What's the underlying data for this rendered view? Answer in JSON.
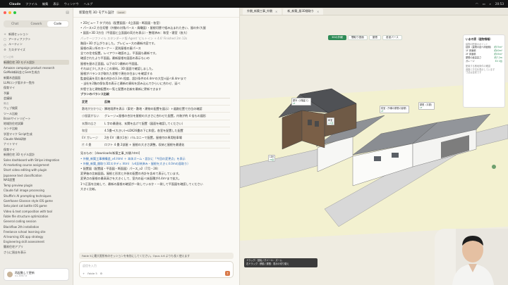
{
  "menubar": {
    "app": "Claude",
    "items": [
      "ファイル",
      "編集",
      "表示",
      "ウィンドウ",
      "ヘルプ"
    ],
    "clock": "20:53"
  },
  "sidebar": {
    "tabs": [
      "Chat",
      "Cowork",
      "Code"
    ],
    "active_tab": "Code",
    "nav": [
      {
        "icon": "+",
        "label": "新規セッション"
      },
      {
        "icon": "▢",
        "label": "アーティファクト"
      },
      {
        "icon": "◷",
        "label": "ルーティン"
      },
      {
        "icon": "⚙",
        "label": "カスタマイズ"
      }
    ],
    "pinned_section": "ピン止め",
    "pinned": [
      "新規住宅 3D モデル設計",
      "Amazon campaign product research",
      "GoMob新料金とGem生成方",
      "新築木造図面",
      "LLMロング版ネタ一覧作",
      "保育マイ",
      "予算",
      "会議録"
    ],
    "recents_section": "最近",
    "recents": [
      "ウェブ検索",
      "ツール比較",
      "Brainサイトリピート",
      "地域別住宅試算",
      "ランチ比較",
      "学習マイク Script生成",
      "Claude Web研修",
      "ナイトマイ",
      "保育マイ",
      "新規住宅 3D モデル設計",
      "Sales dashboard with Stripe integration",
      "AI marketing course assignment",
      "Short video editing with plugin",
      "Japanese text classification",
      "NAS設置",
      "Temp preview plugin",
      "Claude full image processing",
      "Shuffle's AI prompting techniques",
      "Gamfoane Glasnon style iOS game",
      "Seto plant cat battle iOS game",
      "Video & text composition with tool",
      "Fable file structure optimization",
      "General coding session",
      "Blackflow 2th installation",
      "Freelance school learning site",
      "AI learning iOS app strategy",
      "Engineering skill assessment",
      "簡易住宅アプリ",
      "さらに過去を表示"
    ],
    "user_name": "再起動して更新",
    "user_sub": "v1.3567.0",
    "bottom_label": "じゅりりー・Max"
  },
  "chat": {
    "title": "新築住宅 3D モデル設計",
    "title_badge": "Local",
    "lines": [
      "• 2Dビュー 7 タブ対応（配置図面・4立面図・断面図・各室）",
      "• パース×2 方位切替（外観の対角パース・鳥瞰図）・屋根切替で組み込まれた合い、屋の外/大屋",
      "• 図面+3D 3方位（平面図と立面図の両方を表示）・整理済み：和室・寝室（各大）",
      "パッケージファイル  スタンダード版  Agent 'ビルトイン + 4.6' Finished 2m 12s",
      "階段+3D が上がりました。プレビュー大の最新内容です。",
      "屋根の高い所のコーナー・変則屋根の屋パース",
      "全ての住宅配置。レイアウト確認の上、平面図も最新です。",
      "確認されたより平面図。最新屋根を図面の表示もいの",
      "屋根を屋の正面図。以下の1つ最新の平面図。",
      "それほど少し大きくこの資料。3D 図面で確認しました。",
      "屋根がバランスが取れた状態で現在の住まいを確認する",
      "監査役員を見た後の合計の3.3m 程度、設計条件の4.4m²の大型×延べ8.4m²まで",
      "・当社を2階の保存用の表示と最新の資料を読み込んでからいに合わせ、延べ",
      "外壁寸法と建物配置の一覧と配置の比較を最新に更新できます",
      "プランのバランス比較"
    ],
    "table": {
      "headers": [
        "変更",
        "反映"
      ],
      "rows": [
        [
          "敷地が分かりにくい",
          "隣地境界を表示（東宅・敷地・建物の配置を図示）+道路位置で方位の確認"
        ],
        [
          "小屋裏がない",
          "グレージュ屋根の合計を屋根の大きさに合わせた配置。内装が約 4 倍もの図形"
        ],
        [
          "玄関の広さ",
          "L 字の最適化、玄関を広げて配置（図面を確認してください）"
        ],
        [
          "和室",
          "4.5畳→(大きい)→LDK26畳の下に和室。各室を配置した配置"
        ],
        [
          "EV ガレージ",
          "2台 EV（最大1台）バルコニーで配置。屋根付の専用駐車場"
        ],
        [
          "片 4 畳",
          "ロフト 4 畳 2部屋 + 屋根の大きさ調整。収納と屋根を最適化"
        ]
      ]
    },
    "after_lines": [
      "見るもの：[downloads/新築工事_外観.html]",
      "• 外観_新築工事棟構造_v4.html ＋ 本体ズーム・設計に「今回の変更点」を表示",
      "• 外観_新築_間取り3Dスタディ.html （v4反映済み・屋根を大きく4.0mの面取り）",
      "• 配置図（配置図・平面図・断面図）パース_v2（7月・28）",
      "変更後の比較図面。屋根と形状と外装の配置の合計を含めて表示しています。",
      "変更点の屋根の最高高さを大きくして、室内の延べ床面積が4.4m²まで拡大。",
      "1つ正面を比較して、最新の屋根の確認が一致しているか・一致して平面図を確認してください",
      "大きく比較。"
    ],
    "notice": "Fable 5に最大限所有のセッションを有効にしてください。Opus 4.6 よりも長く使えます",
    "composer_placeholder": "返信を入力",
    "composer_tools": [
      "+",
      "Fable 5",
      "⚙"
    ]
  },
  "viewer": {
    "tabs": [
      {
        "label": "外観_新築工事_外観",
        "closable": true
      },
      {
        "label": "新_新築_屋3D間取り",
        "closable": true
      }
    ],
    "view_buttons": [
      "3Dの外観",
      "間取り図面",
      "屋根",
      "各室パース"
    ],
    "active_view": "3Dの外観",
    "legend": {
      "title": "いまの家（建物情報）",
      "subtitle": "建物の配置のポイント",
      "rows": [
        {
          "k": "延床（建物の延べ床面積）",
          "v": "約75m²"
        },
        {
          "k": "1F 床面積",
          "v": "約40m²"
        },
        {
          "k": "2F 床面積",
          "v": "約35m²"
        },
        {
          "k": "屋根の最高高さ",
          "v": "約7.2m"
        },
        {
          "k": "ガレージ",
          "v": "EV 2台"
        }
      ],
      "notes": [
        "配置する敷地条件の確認",
        "道路と方位を表示しています",
        "寸法は目安です"
      ]
    },
    "labels": [
      {
        "name": "屋外（2階建て）",
        "sub": "2F"
      },
      {
        "name": "和室",
        "sub": "4.5畳"
      },
      {
        "name": "寝室（予備の屋根の部屋）",
        "sub": "2F"
      },
      {
        "name": "屋根（平屋）",
        "sub": "1F"
      },
      {
        "name": "LDK",
        "sub": "26畳"
      }
    ],
    "status_lines": [
      "ドラッグ：回転 / ホイール：ズーム",
      "右ドラッグ：移動 / 屋根：表示の切り替え"
    ]
  }
}
